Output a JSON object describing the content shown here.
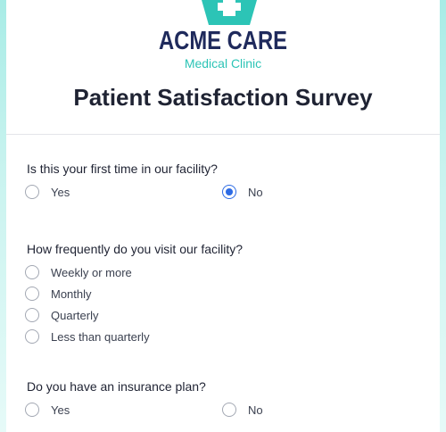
{
  "header": {
    "brand_name": "ACME CARE",
    "brand_subtitle": "Medical Clinic",
    "logo_icon": "medical-cross-icon",
    "title": "Patient Satisfaction Survey"
  },
  "colors": {
    "brand_navy": "#1f2a5c",
    "brand_teal": "#2cc4b6",
    "selected": "#2d6be4"
  },
  "questions": [
    {
      "label": "Is this your first time in our facility?",
      "options": [
        "Yes",
        "No"
      ],
      "selected": "No"
    },
    {
      "label": "How frequently do you visit our facility?",
      "options": [
        "Weekly or more",
        "Monthly",
        "Quarterly",
        "Less than quarterly"
      ],
      "selected": null
    },
    {
      "label": "Do you have an insurance plan?",
      "options": [
        "Yes",
        "No"
      ],
      "selected": null
    }
  ]
}
